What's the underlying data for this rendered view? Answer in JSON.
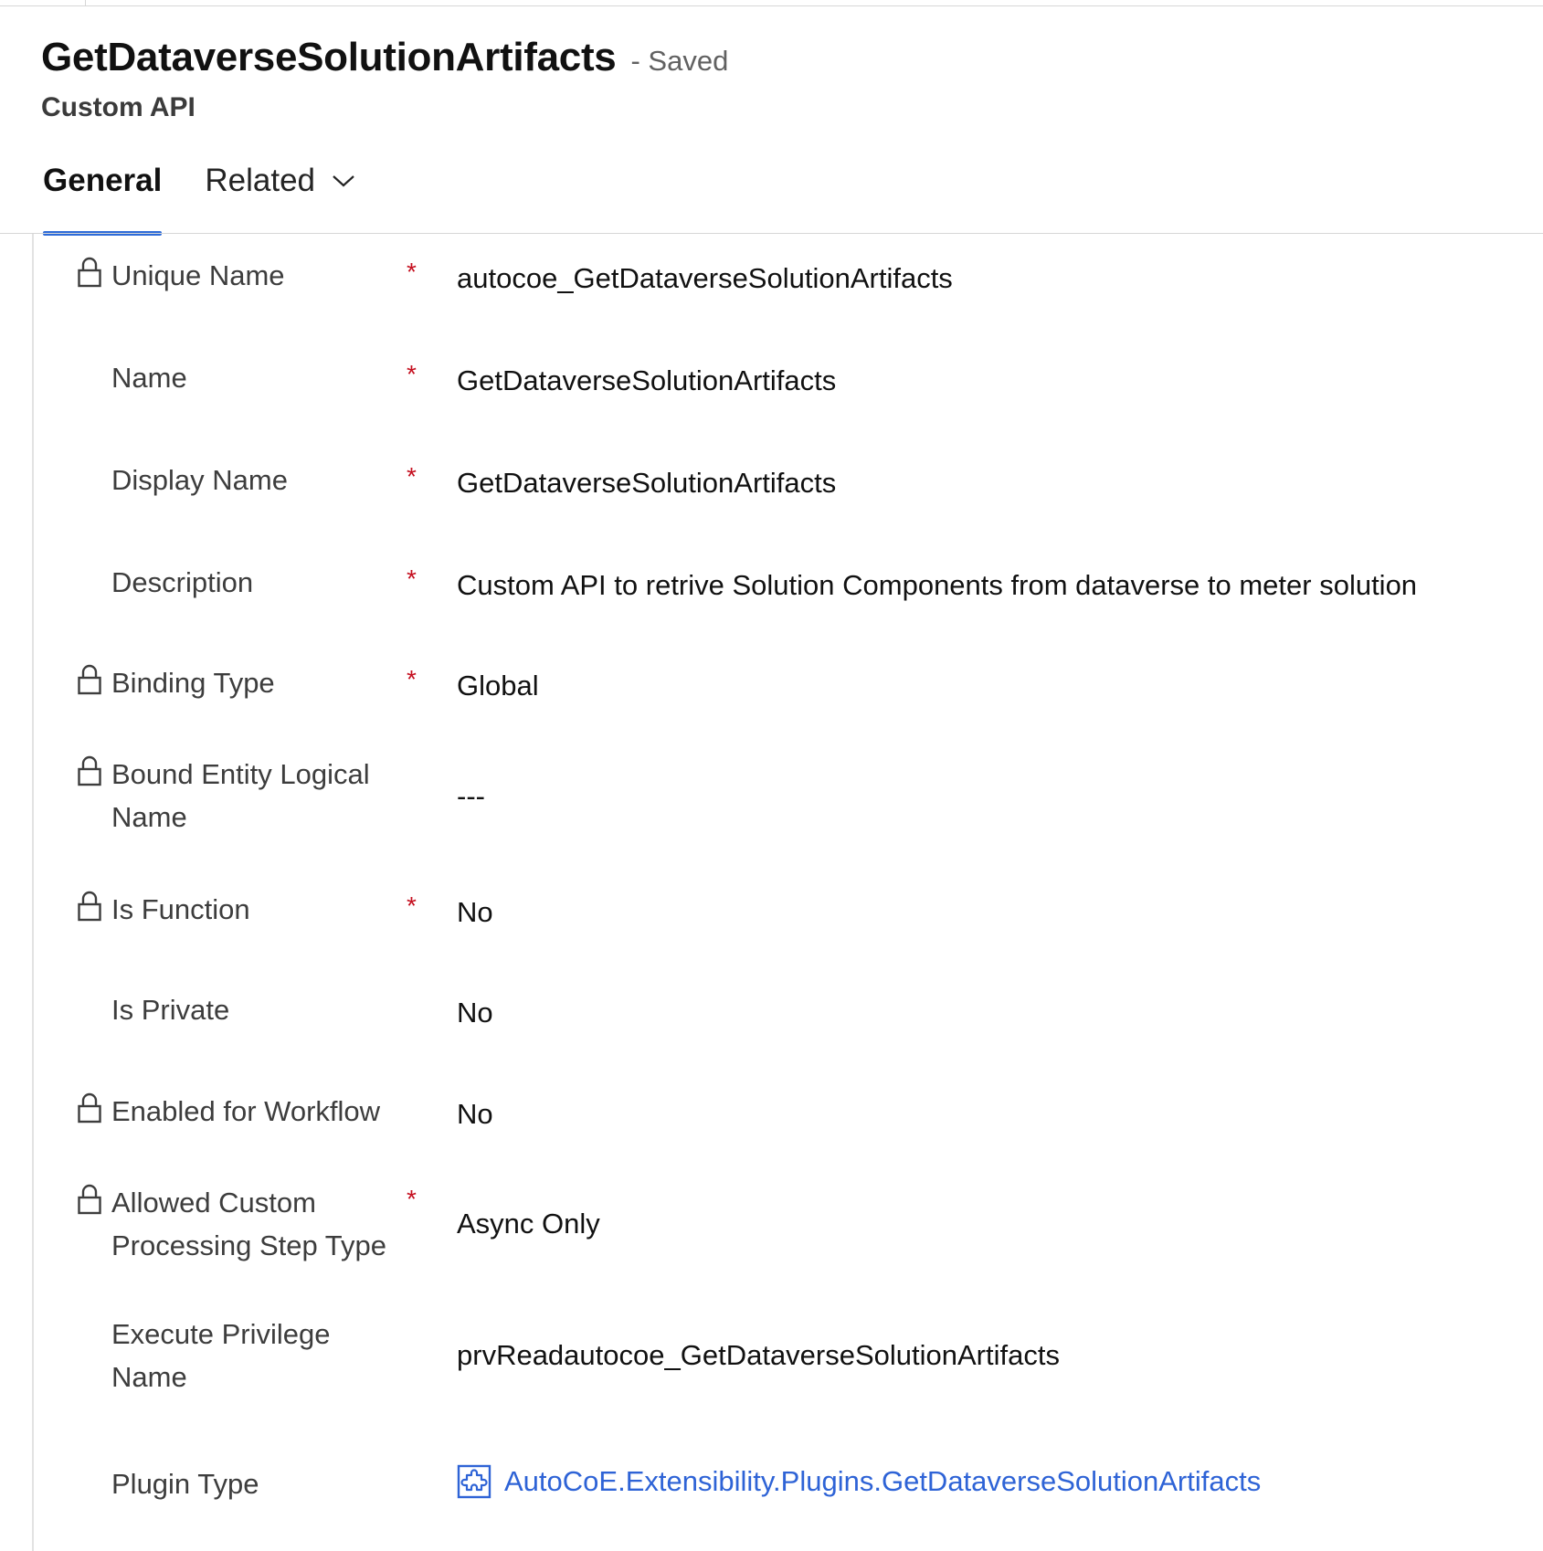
{
  "header": {
    "title": "GetDataverseSolutionArtifacts",
    "status": "- Saved",
    "entity_type": "Custom API"
  },
  "tabs": [
    {
      "label": "General",
      "selected": true
    },
    {
      "label": "Related",
      "selected": false
    }
  ],
  "fields": [
    {
      "label": "Unique Name",
      "value": "autocoe_GetDataverseSolutionArtifacts",
      "required": "*",
      "locked": true
    },
    {
      "label": "Name",
      "value": "GetDataverseSolutionArtifacts",
      "required": "*",
      "locked": false
    },
    {
      "label": "Display Name",
      "value": "GetDataverseSolutionArtifacts",
      "required": "*",
      "locked": false
    },
    {
      "label": "Description",
      "value": "Custom API to retrive Solution Components from dataverse to meter solution",
      "required": "*",
      "locked": false
    },
    {
      "label": "Binding Type",
      "value": "Global",
      "required": "*",
      "locked": true
    },
    {
      "label": "Bound Entity Logical Name",
      "value": "---",
      "required": "",
      "locked": true
    },
    {
      "label": "Is Function",
      "value": "No",
      "required": "*",
      "locked": true
    },
    {
      "label": "Is Private",
      "value": "No",
      "required": "",
      "locked": false
    },
    {
      "label": "Enabled for Workflow",
      "value": "No",
      "required": "",
      "locked": true
    },
    {
      "label": "Allowed Custom Processing Step Type",
      "value": "Async Only",
      "required": "*",
      "locked": true
    },
    {
      "label": "Execute Privilege Name",
      "value": "prvReadautocoe_GetDataverseSolutionArtifacts",
      "required": "",
      "locked": false
    },
    {
      "label": "Plugin Type",
      "value": "AutoCoE.Extensibility.Plugins.GetDataverseSolutionArtifacts",
      "required": "",
      "locked": false
    }
  ],
  "colors": {
    "accent": "#2e6bd8",
    "required": "#c50f1f",
    "link": "#2e63d6"
  },
  "icons": [
    "lock-icon",
    "chevron-down-icon",
    "plugin-type-icon"
  ]
}
